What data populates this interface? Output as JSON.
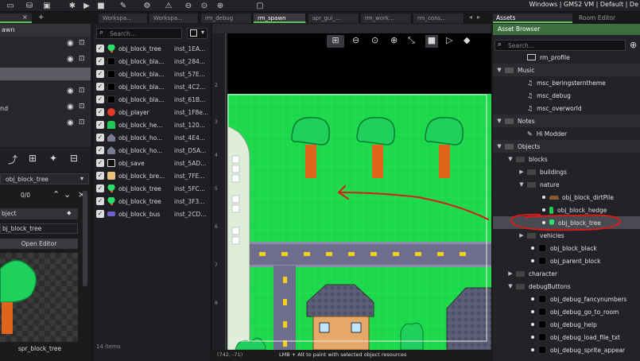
{
  "window": {
    "title_right": "Windows | GMS2 VM | Default | De"
  },
  "tabs": [
    {
      "label": "Workspa..."
    },
    {
      "label": "Workspa..."
    },
    {
      "label": "rm_debug"
    },
    {
      "label": "rm_spawn"
    },
    {
      "label": "spr_gui_..."
    },
    {
      "label": "rm_work..."
    },
    {
      "label": "rm_cons..."
    }
  ],
  "right_tabs": {
    "assets": "Assets",
    "room_editor": "Room Editor"
  },
  "layers": {
    "header": "awn",
    "items": [
      "",
      "",
      "",
      "",
      "nd",
      ""
    ]
  },
  "left_props": {
    "object_name": "obj_block_tree",
    "counter": "0/0",
    "section_label": "bject",
    "object_field": "bj_block_tree",
    "open_editor": "Open Editor",
    "sprite_name": "spr_block_tree"
  },
  "instances": {
    "search_placeholder": "Search...",
    "rows": [
      {
        "name": "obj_block_tree",
        "id": "inst_1EA...",
        "swatch": "tree"
      },
      {
        "name": "obj_block_bla...",
        "id": "inst_284...",
        "swatch": "black"
      },
      {
        "name": "obj_block_bla...",
        "id": "inst_57E...",
        "swatch": "black"
      },
      {
        "name": "obj_block_bla...",
        "id": "inst_4C2...",
        "swatch": "black"
      },
      {
        "name": "obj_block_bla...",
        "id": "inst_61B...",
        "swatch": "black"
      },
      {
        "name": "obj_player",
        "id": "inst_1F8e...",
        "swatch": "player"
      },
      {
        "name": "obj_block_he...",
        "id": "inst_120...",
        "swatch": "hedge"
      },
      {
        "name": "obj_block_ho...",
        "id": "inst_4E4...",
        "swatch": "house"
      },
      {
        "name": "obj_block_ho...",
        "id": "inst_D5A...",
        "swatch": "house"
      },
      {
        "name": "obj_save",
        "id": "inst_5AD...",
        "swatch": "save"
      },
      {
        "name": "obj_block_bre...",
        "id": "inst_7FE...",
        "swatch": "bread"
      },
      {
        "name": "obj_block_tree",
        "id": "inst_5FC...",
        "swatch": "tree"
      },
      {
        "name": "obj_block_tree",
        "id": "inst_3F3...",
        "swatch": "tree"
      },
      {
        "name": "obj_block_bus",
        "id": "inst_2CD...",
        "swatch": "bus"
      }
    ],
    "footer": "14 items"
  },
  "room": {
    "status_coords": "(742, -71)",
    "status_hint": "LMB + Alt to paint with selected object resources",
    "ruler_marks": [
      "2",
      "3",
      "4",
      "5",
      "6",
      "7",
      "8"
    ]
  },
  "assets": {
    "browser_label": "Asset Browser",
    "search_placeholder": "Search...",
    "rows": [
      {
        "label": "rm_profile",
        "kind": "room",
        "indent": 2
      },
      {
        "label": "Music",
        "kind": "group-open",
        "indent": 0
      },
      {
        "label": "msc_beringsterntheme",
        "kind": "sound",
        "indent": 2
      },
      {
        "label": "msc_debug",
        "kind": "sound",
        "indent": 2
      },
      {
        "label": "msc_overworld",
        "kind": "sound",
        "indent": 2
      },
      {
        "label": "Notes",
        "kind": "group-open",
        "indent": 0
      },
      {
        "label": "Hi Modder",
        "kind": "note",
        "indent": 2
      },
      {
        "label": "Objects",
        "kind": "group-open",
        "indent": 0
      },
      {
        "label": "blocks",
        "kind": "folder-open",
        "indent": 1
      },
      {
        "label": "buildings",
        "kind": "folder-closed",
        "indent": 2
      },
      {
        "label": "nature",
        "kind": "folder-open",
        "indent": 2
      },
      {
        "label": "obj_block_dirtPile",
        "kind": "dirt",
        "indent": 3
      },
      {
        "label": "obj_block_hedge",
        "kind": "hedge",
        "indent": 3
      },
      {
        "label": "obj_block_tree",
        "kind": "tree",
        "indent": 3,
        "selected": true
      },
      {
        "label": "vehicles",
        "kind": "folder-closed",
        "indent": 2
      },
      {
        "label": "obj_block_black",
        "kind": "black",
        "indent": 2
      },
      {
        "label": "obj_parent_block",
        "kind": "black",
        "indent": 2
      },
      {
        "label": "character",
        "kind": "folder-closed",
        "indent": 1
      },
      {
        "label": "debugButtons",
        "kind": "folder-open",
        "indent": 1
      },
      {
        "label": "obj_debug_fancynumbers",
        "kind": "black",
        "indent": 2
      },
      {
        "label": "obj_debug_go_to_room",
        "kind": "black",
        "indent": 2
      },
      {
        "label": "obj_debug_help",
        "kind": "black",
        "indent": 2
      },
      {
        "label": "obj_debug_load_file_txt",
        "kind": "black",
        "indent": 2
      },
      {
        "label": "obj_debug_sprite_appear",
        "kind": "black",
        "indent": 2
      }
    ]
  },
  "colors": {
    "accent": "#58c35c",
    "grass": "#1bd94a",
    "road": "#6e6d8c",
    "road_line": "#f5d21a",
    "annotation": "#d81b1b"
  }
}
